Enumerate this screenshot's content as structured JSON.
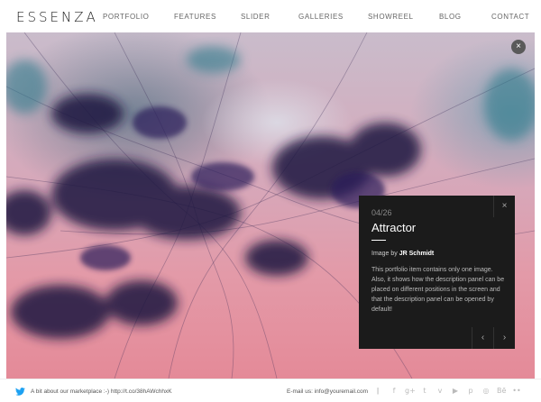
{
  "header": {
    "logo": "ESSENZA",
    "nav": [
      "PORTFOLIO",
      "FEATURES",
      "SLIDER",
      "GALLERIES",
      "SHOWREEL",
      "BLOG",
      "CONTACT"
    ]
  },
  "hero": {
    "close_label": "×"
  },
  "panel": {
    "counter": "04/26",
    "title": "Attractor",
    "credit_prefix": "Image by ",
    "credit_name": "JR Schmidt",
    "description": "This portfolio item contains only one image. Also, it shows how the description panel can be placed on different positions in the screen and that the description panel can be opened by default!",
    "close_label": "×",
    "prev_label": "‹",
    "next_label": "›"
  },
  "footer": {
    "tweet": "A bit about our marketplace :-) http://t.co/38hAWchhxK",
    "email_label": "E-mail us: info@youremail.com",
    "separator": "|",
    "social_icons": [
      "facebook-icon",
      "google-plus-icon",
      "twitter-icon",
      "vimeo-icon",
      "youtube-icon",
      "pinterest-icon",
      "dribbble-icon",
      "behance-icon",
      "flickr-icon"
    ],
    "social_glyphs": [
      "f",
      "g+",
      "t",
      "v",
      "▶",
      "p",
      "◎",
      "Bē",
      "••"
    ]
  },
  "colors": {
    "accent_twitter": "#1da1f2",
    "panel_bg": "#1b1b1b"
  }
}
